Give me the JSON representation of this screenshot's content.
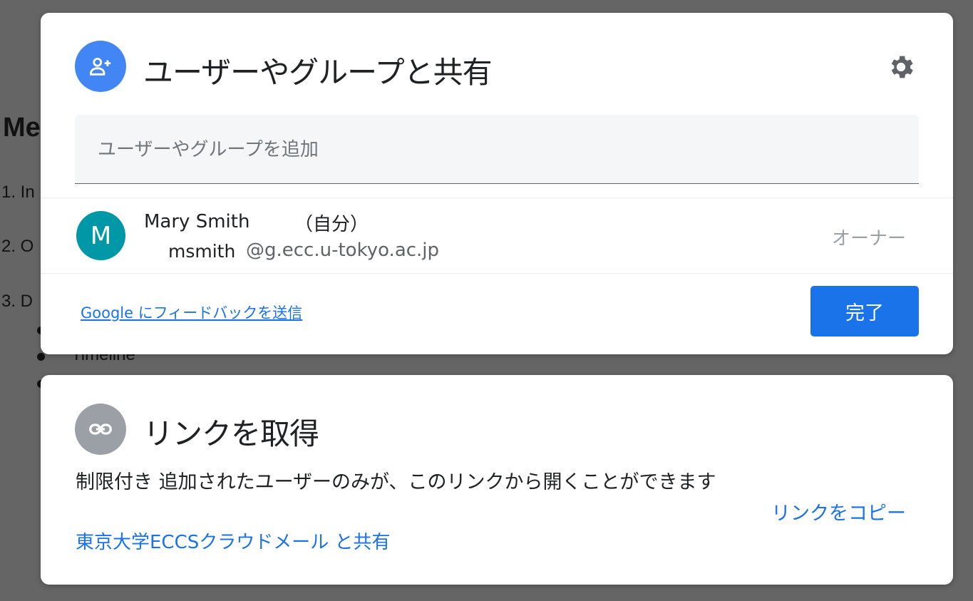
{
  "background": {
    "heading": "Me",
    "lines": [
      "1. In",
      "2. O",
      "3. D"
    ],
    "bullet_text": "Timeline"
  },
  "share_dialog": {
    "title": "ユーザーやグループと共有",
    "icon": "person-add-icon",
    "settings_icon": "gear-icon",
    "add_placeholder": "ユーザーやグループを追加",
    "member": {
      "avatar_letter": "M",
      "avatar_color": "#0097a7",
      "name": "Mary Smith",
      "self_label": "（自分）",
      "username": "msmith",
      "domain": "@g.ecc.u-tokyo.ac.jp",
      "role": "オーナー"
    },
    "feedback_link": "Google にフィードバックを送信",
    "done_label": "完了"
  },
  "link_dialog": {
    "title": "リンクを取得",
    "icon": "link-icon",
    "restriction_text": "制限付き 追加されたユーザーのみが、このリンクから開くことができます",
    "share_org_link": "東京大学ECCSクラウドメール と共有",
    "copy_link_label": "リンクをコピー"
  },
  "colors": {
    "accent": "#1a73e8",
    "share_icon_bg": "#4285f4",
    "link_icon_bg": "#9aa0a6",
    "overlay": "#656565"
  }
}
